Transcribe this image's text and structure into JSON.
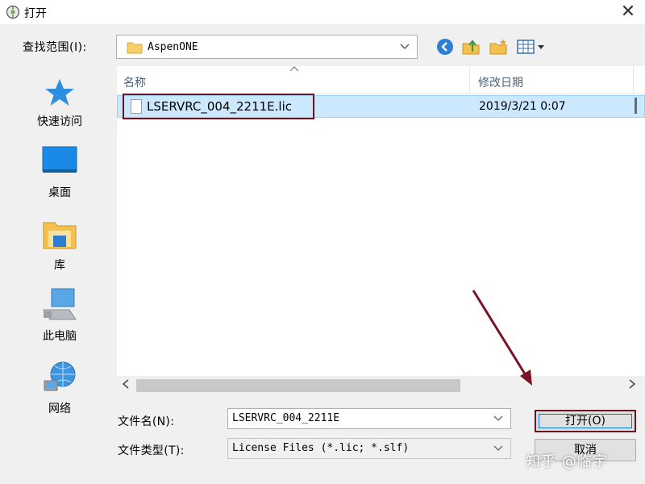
{
  "window": {
    "title": "打开",
    "close_glyph": "✕"
  },
  "look_in": {
    "label": "查找范围(I):",
    "value": "AspenONE"
  },
  "toolbar": {
    "icons": [
      "back-icon",
      "up-folder-icon",
      "new-folder-icon",
      "view-menu-icon"
    ]
  },
  "places": [
    {
      "label": "快速访问",
      "icon": "star-icon"
    },
    {
      "label": "桌面",
      "icon": "desktop-icon"
    },
    {
      "label": "库",
      "icon": "library-icon"
    },
    {
      "label": "此电脑",
      "icon": "computer-icon"
    },
    {
      "label": "网络",
      "icon": "network-icon"
    }
  ],
  "file_list": {
    "columns": [
      "名称",
      "修改日期"
    ],
    "rows": [
      {
        "name": "LSERVRC_004_2211E.lic",
        "modified": "2019/3/21 0:07",
        "selected": true
      }
    ]
  },
  "file_name": {
    "label": "文件名(N):",
    "value": "LSERVRC_004_2211E"
  },
  "file_type": {
    "label": "文件类型(T):",
    "value": "License Files (*.lic; *.slf)"
  },
  "buttons": {
    "open": "打开(O)",
    "cancel": "取消"
  },
  "watermark": "知乎 @临宇",
  "colors": {
    "selection": "#cce8ff",
    "highlight_box": "#6b1322",
    "annotation_arrow": "#7a1526"
  }
}
